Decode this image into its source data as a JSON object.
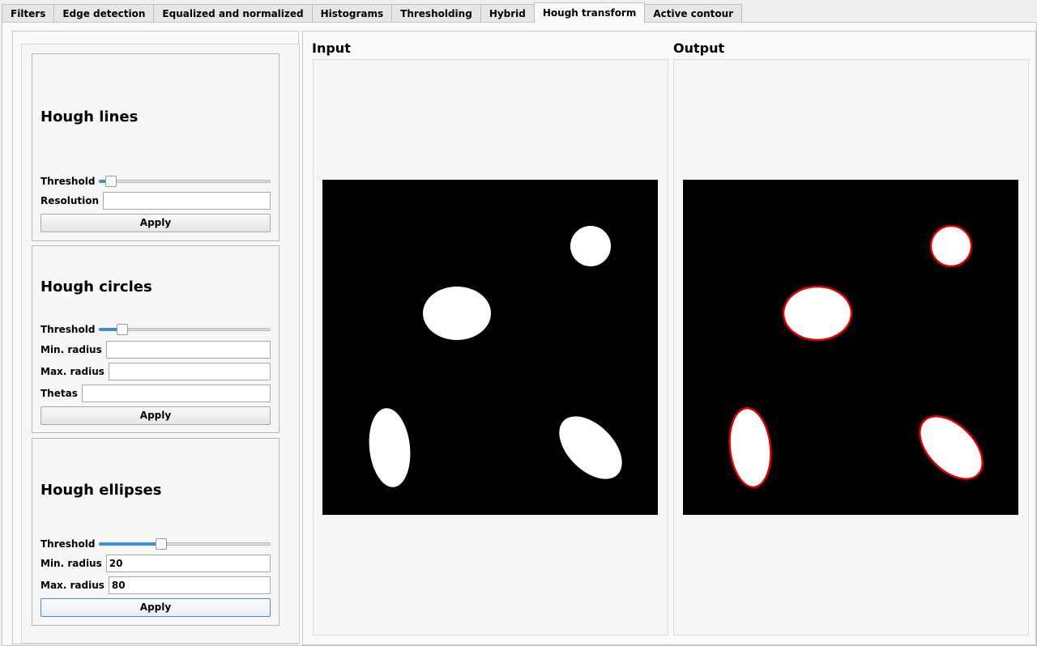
{
  "tabs": [
    {
      "label": "Filters",
      "active": false
    },
    {
      "label": "Edge detection",
      "active": false
    },
    {
      "label": "Equalized and normalized",
      "active": false
    },
    {
      "label": "Histograms",
      "active": false
    },
    {
      "label": "Thresholding",
      "active": false
    },
    {
      "label": "Hybrid",
      "active": false
    },
    {
      "label": "Hough transform",
      "active": true
    },
    {
      "label": "Active contour",
      "active": false
    }
  ],
  "hough_lines": {
    "title": "Hough lines",
    "threshold_label": "Threshold",
    "threshold_level": 0.04,
    "resolution_label": "Resolution",
    "resolution_value": "",
    "apply_label": "Apply"
  },
  "hough_circles": {
    "title": "Hough circles",
    "threshold_label": "Threshold",
    "threshold_level": 0.11,
    "min_radius_label": "Min. radius",
    "min_radius_value": "",
    "max_radius_label": "Max. radius",
    "max_radius_value": "",
    "thetas_label": "Thetas",
    "thetas_value": "",
    "apply_label": "Apply"
  },
  "hough_ellipses": {
    "title": "Hough ellipses",
    "threshold_label": "Threshold",
    "threshold_level": 0.35,
    "min_radius_label": "Min. radius",
    "min_radius_value": "20",
    "max_radius_label": "Max. radius",
    "max_radius_value": "80",
    "apply_label": "Apply"
  },
  "images": {
    "input_label": "Input",
    "output_label": "Output",
    "detection_color": "#dd0000"
  }
}
